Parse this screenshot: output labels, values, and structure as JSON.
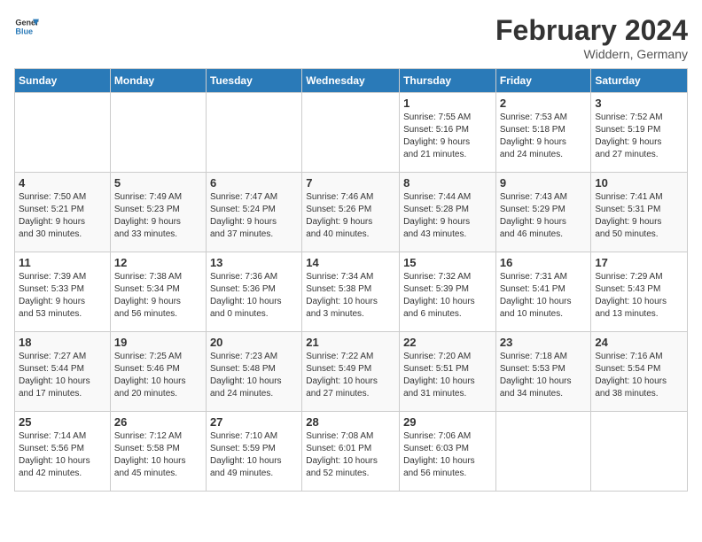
{
  "logo": {
    "line1": "General",
    "line2": "Blue"
  },
  "header": {
    "month_year": "February 2024",
    "location": "Widdern, Germany"
  },
  "days_of_week": [
    "Sunday",
    "Monday",
    "Tuesday",
    "Wednesday",
    "Thursday",
    "Friday",
    "Saturday"
  ],
  "weeks": [
    [
      {
        "day": "",
        "text": ""
      },
      {
        "day": "",
        "text": ""
      },
      {
        "day": "",
        "text": ""
      },
      {
        "day": "",
        "text": ""
      },
      {
        "day": "1",
        "text": "Sunrise: 7:55 AM\nSunset: 5:16 PM\nDaylight: 9 hours\nand 21 minutes."
      },
      {
        "day": "2",
        "text": "Sunrise: 7:53 AM\nSunset: 5:18 PM\nDaylight: 9 hours\nand 24 minutes."
      },
      {
        "day": "3",
        "text": "Sunrise: 7:52 AM\nSunset: 5:19 PM\nDaylight: 9 hours\nand 27 minutes."
      }
    ],
    [
      {
        "day": "4",
        "text": "Sunrise: 7:50 AM\nSunset: 5:21 PM\nDaylight: 9 hours\nand 30 minutes."
      },
      {
        "day": "5",
        "text": "Sunrise: 7:49 AM\nSunset: 5:23 PM\nDaylight: 9 hours\nand 33 minutes."
      },
      {
        "day": "6",
        "text": "Sunrise: 7:47 AM\nSunset: 5:24 PM\nDaylight: 9 hours\nand 37 minutes."
      },
      {
        "day": "7",
        "text": "Sunrise: 7:46 AM\nSunset: 5:26 PM\nDaylight: 9 hours\nand 40 minutes."
      },
      {
        "day": "8",
        "text": "Sunrise: 7:44 AM\nSunset: 5:28 PM\nDaylight: 9 hours\nand 43 minutes."
      },
      {
        "day": "9",
        "text": "Sunrise: 7:43 AM\nSunset: 5:29 PM\nDaylight: 9 hours\nand 46 minutes."
      },
      {
        "day": "10",
        "text": "Sunrise: 7:41 AM\nSunset: 5:31 PM\nDaylight: 9 hours\nand 50 minutes."
      }
    ],
    [
      {
        "day": "11",
        "text": "Sunrise: 7:39 AM\nSunset: 5:33 PM\nDaylight: 9 hours\nand 53 minutes."
      },
      {
        "day": "12",
        "text": "Sunrise: 7:38 AM\nSunset: 5:34 PM\nDaylight: 9 hours\nand 56 minutes."
      },
      {
        "day": "13",
        "text": "Sunrise: 7:36 AM\nSunset: 5:36 PM\nDaylight: 10 hours\nand 0 minutes."
      },
      {
        "day": "14",
        "text": "Sunrise: 7:34 AM\nSunset: 5:38 PM\nDaylight: 10 hours\nand 3 minutes."
      },
      {
        "day": "15",
        "text": "Sunrise: 7:32 AM\nSunset: 5:39 PM\nDaylight: 10 hours\nand 6 minutes."
      },
      {
        "day": "16",
        "text": "Sunrise: 7:31 AM\nSunset: 5:41 PM\nDaylight: 10 hours\nand 10 minutes."
      },
      {
        "day": "17",
        "text": "Sunrise: 7:29 AM\nSunset: 5:43 PM\nDaylight: 10 hours\nand 13 minutes."
      }
    ],
    [
      {
        "day": "18",
        "text": "Sunrise: 7:27 AM\nSunset: 5:44 PM\nDaylight: 10 hours\nand 17 minutes."
      },
      {
        "day": "19",
        "text": "Sunrise: 7:25 AM\nSunset: 5:46 PM\nDaylight: 10 hours\nand 20 minutes."
      },
      {
        "day": "20",
        "text": "Sunrise: 7:23 AM\nSunset: 5:48 PM\nDaylight: 10 hours\nand 24 minutes."
      },
      {
        "day": "21",
        "text": "Sunrise: 7:22 AM\nSunset: 5:49 PM\nDaylight: 10 hours\nand 27 minutes."
      },
      {
        "day": "22",
        "text": "Sunrise: 7:20 AM\nSunset: 5:51 PM\nDaylight: 10 hours\nand 31 minutes."
      },
      {
        "day": "23",
        "text": "Sunrise: 7:18 AM\nSunset: 5:53 PM\nDaylight: 10 hours\nand 34 minutes."
      },
      {
        "day": "24",
        "text": "Sunrise: 7:16 AM\nSunset: 5:54 PM\nDaylight: 10 hours\nand 38 minutes."
      }
    ],
    [
      {
        "day": "25",
        "text": "Sunrise: 7:14 AM\nSunset: 5:56 PM\nDaylight: 10 hours\nand 42 minutes."
      },
      {
        "day": "26",
        "text": "Sunrise: 7:12 AM\nSunset: 5:58 PM\nDaylight: 10 hours\nand 45 minutes."
      },
      {
        "day": "27",
        "text": "Sunrise: 7:10 AM\nSunset: 5:59 PM\nDaylight: 10 hours\nand 49 minutes."
      },
      {
        "day": "28",
        "text": "Sunrise: 7:08 AM\nSunset: 6:01 PM\nDaylight: 10 hours\nand 52 minutes."
      },
      {
        "day": "29",
        "text": "Sunrise: 7:06 AM\nSunset: 6:03 PM\nDaylight: 10 hours\nand 56 minutes."
      },
      {
        "day": "",
        "text": ""
      },
      {
        "day": "",
        "text": ""
      }
    ]
  ]
}
